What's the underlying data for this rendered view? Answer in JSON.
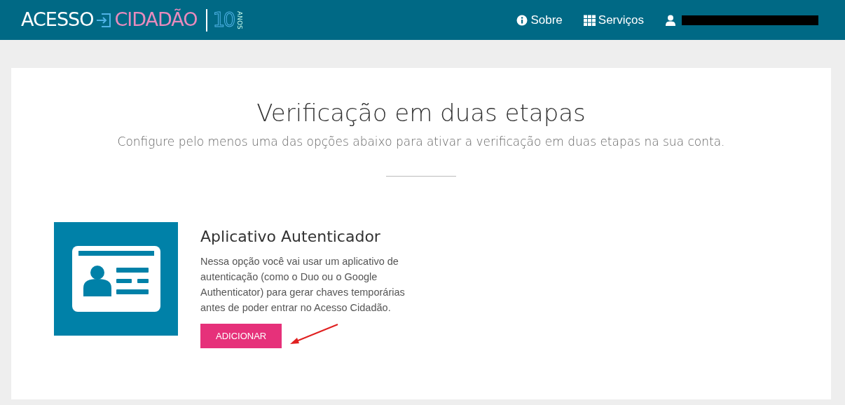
{
  "logo": {
    "word_1": "ACESSO",
    "word_2": "CIDADÃO",
    "anniversary_number": "10",
    "anniversary_label": "ANOS"
  },
  "nav_items": [
    {
      "kind": "info",
      "label": "Sobre"
    },
    {
      "kind": "grid",
      "label": "Serviços"
    },
    {
      "kind": "user"
    }
  ],
  "page": {
    "title": "Verificação em duas etapas",
    "subtitle": "Configure pelo menos uma das opções abaixo para ativar a verificação em duas etapas na sua conta."
  },
  "options": [
    {
      "title": "Aplicativo Autenticador",
      "description": "Nessa opção você vai usar um aplicativo de autenticação (como o Duo ou o Google Authenticator) para gerar chaves temporárias antes de poder entrar no Acesso Cidadão.",
      "button": "ADICIONAR"
    }
  ]
}
